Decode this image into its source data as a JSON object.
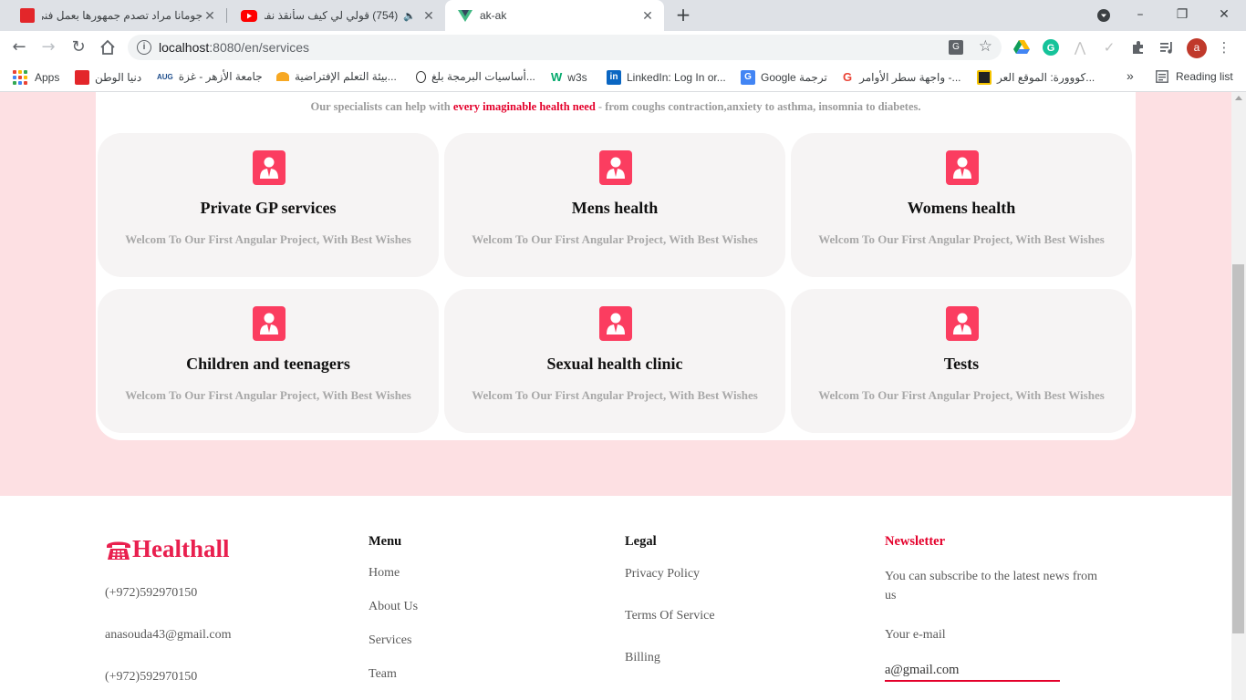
{
  "browser": {
    "tabs": [
      {
        "title": "جومانا مراد تصدم جمهورها بعمل فني",
        "favicon_color": "#e3262a"
      },
      {
        "title": "(754) قولي لي كيف سأنقذ نفسي",
        "favicon_color": "#ff0000",
        "audio_icon": "speaker-icon"
      },
      {
        "title": "ak-ak",
        "favicon_color": "#41b883",
        "active": true
      }
    ],
    "new_tab_label": "+",
    "window_controls": {
      "minimize": "–",
      "restore": "❐",
      "close": "✕"
    },
    "url": {
      "host": "localhost",
      "rest": ":8080/en/services"
    },
    "avatar_letter": "a",
    "bookmarks": [
      {
        "label": "Apps",
        "icon": "apps-grid-icon"
      },
      {
        "label": "دنيا الوطن",
        "color": "#e3262a"
      },
      {
        "label": "جامعة الأزهر - غزة",
        "badge": "AUG",
        "color": "#1f4e8c"
      },
      {
        "label": "بيئة التعلم الإفتراضية...",
        "color": "#f7a823"
      },
      {
        "label": "أساسيات البرمجة بلغ...",
        "color": "#333333"
      },
      {
        "label": "w3s",
        "color": "#04aa6d"
      },
      {
        "label": "LinkedIn: Log In or...",
        "color": "#0a66c2"
      },
      {
        "label": "Google ترجمة",
        "color": "#4285f4"
      },
      {
        "label": "واجهة سطر الأوامر -...",
        "color": "#ea4335"
      },
      {
        "label": "كووورة: الموقع العر...",
        "color": "#f5c400"
      }
    ],
    "bookmarks_overflow": "»",
    "reading_list": "Reading list"
  },
  "services": {
    "intro_prefix": "Our specialists can help with ",
    "intro_highlight": "every imaginable health need",
    "intro_suffix": " - from coughs contraction,anxiety to asthma, insomnia to diabetes.",
    "cards": [
      {
        "title": "Private GP services",
        "desc": "Welcom To Our First Angular Project, With Best Wishes",
        "icon": "doctor-icon"
      },
      {
        "title": "Mens health",
        "desc": "Welcom To Our First Angular Project, With Best Wishes",
        "icon": "doctor-icon"
      },
      {
        "title": "Womens health",
        "desc": "Welcom To Our First Angular Project, With Best Wishes",
        "icon": "doctor-icon"
      },
      {
        "title": "Children and teenagers",
        "desc": "Welcom To Our First Angular Project, With Best Wishes",
        "icon": "doctor-icon"
      },
      {
        "title": "Sexual health clinic",
        "desc": "Welcom To Our First Angular Project, With Best Wishes",
        "icon": "doctor-icon"
      },
      {
        "title": "Tests",
        "desc": "Welcom To Our First Angular Project, With Best Wishes",
        "icon": "doctor-icon"
      }
    ]
  },
  "footer": {
    "brand": "Healthall",
    "brand_icon": "telephone-icon",
    "brand_color": "#e9204f",
    "contact": [
      "(+972)592970150",
      "anasouda43@gmail.com",
      "(+972)592970150"
    ],
    "menu": {
      "title": "Menu",
      "items": [
        "Home",
        "About Us",
        "Services",
        "Team"
      ]
    },
    "legal": {
      "title": "Legal",
      "items": [
        "Privacy Policy",
        "Terms Of Service",
        "Billing"
      ]
    },
    "newsletter": {
      "title": "Newsletter",
      "text": "You can subscribe to the latest news from us",
      "email_label": "Your e-mail",
      "email_value": "a@gmail.com"
    }
  },
  "colors": {
    "accent": "#e4002b",
    "icon_bg": "#fb3d60",
    "pink_band": "#fde0e3",
    "card_bg": "#f6f4f4"
  }
}
